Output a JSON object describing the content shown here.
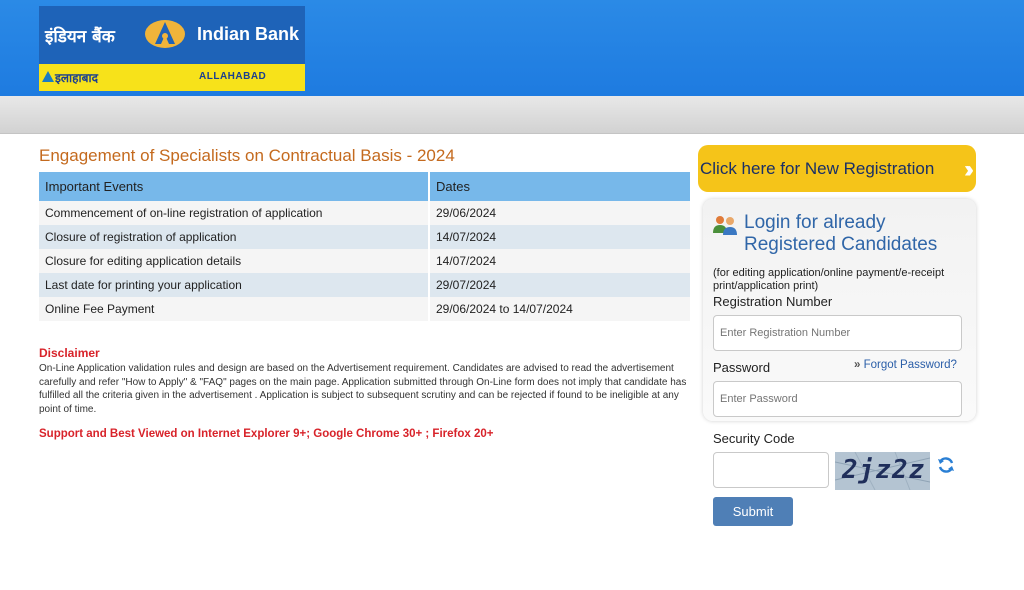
{
  "logo": {
    "hindi_name": "इंडियन बैंक",
    "english_name": "Indian Bank",
    "allahabad_hindi": "इलाहाबाद",
    "allahabad_english": "ALLAHABAD"
  },
  "main": {
    "title": "Engagement of Specialists on Contractual Basis - 2024",
    "table": {
      "headers": [
        "Important Events",
        "Dates"
      ],
      "rows": [
        {
          "event": "Commencement of on-line registration of application",
          "date": "29/06/2024"
        },
        {
          "event": "Closure of registration of application",
          "date": "14/07/2024"
        },
        {
          "event": "Closure for editing application details",
          "date": "14/07/2024"
        },
        {
          "event": "Last date for printing your application",
          "date": "29/07/2024"
        },
        {
          "event": "Online Fee Payment",
          "date": "29/06/2024 to 14/07/2024"
        }
      ]
    },
    "disclaimer_title": "Disclaimer",
    "disclaimer_text": "On-Line Application validation rules and design are based on the Advertisement requirement. Candidates are advised to read the advertisement carefully and refer \"How to Apply\" & \"FAQ\" pages on the main page. Application submitted through On-Line form does not imply that candidate has fulfilled all the criteria given in the advertisement . Application is subject to subsequent scrutiny and can be rejected if found to be ineligible at any point of time.",
    "support_text": "Support and Best Viewed on Internet Explorer 9+; Google Chrome 30+ ; Firefox 20+"
  },
  "sidebar": {
    "new_registration_label": "Click here for New Registration",
    "login_title": "Login for already Registered Candidates",
    "login_subtitle": "(for editing application/online payment/e-receipt print/application print)",
    "registration_label": "Registration Number",
    "registration_placeholder": "Enter Registration Number",
    "password_label": "Password",
    "password_placeholder": "Enter Password",
    "forgot_password": "Forgot Password?",
    "security_label": "Security Code",
    "security_value": "",
    "captcha_text": "2jz2z",
    "submit_label": "Submit"
  },
  "colors": {
    "header_blue": "#1e7be0",
    "title_orange": "#c46a1e",
    "table_header": "#77b8ea",
    "disclaimer_red": "#d8232a",
    "registration_yellow": "#f5c419",
    "submit_blue": "#4f7fb6"
  }
}
